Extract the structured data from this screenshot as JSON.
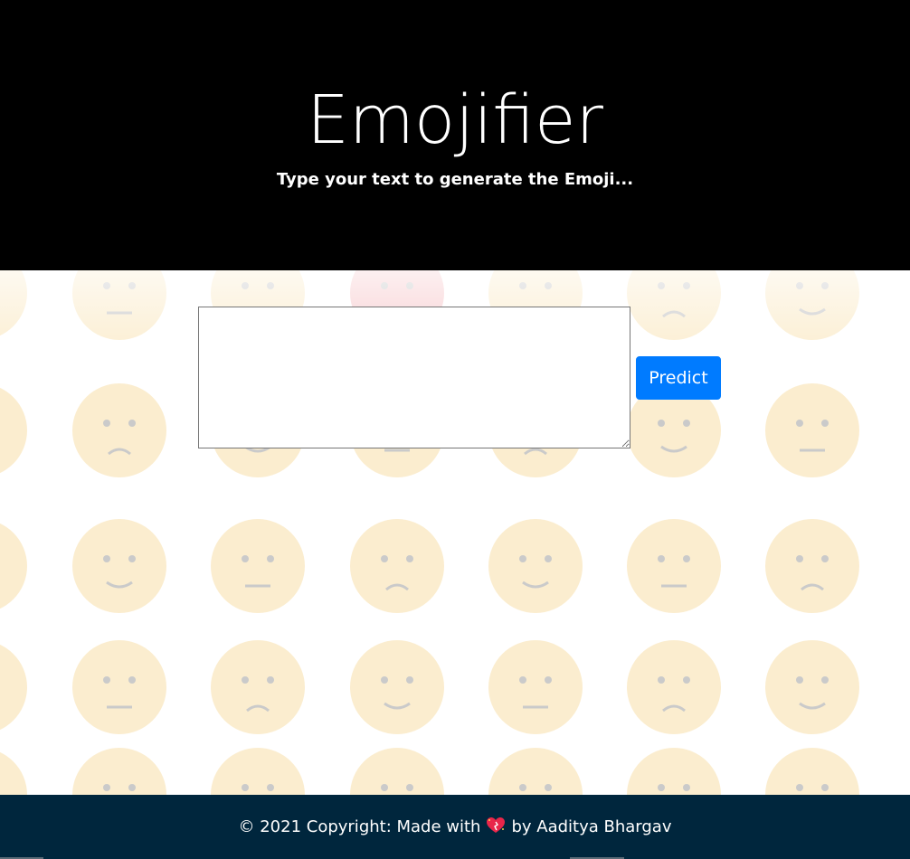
{
  "header": {
    "title": "Emojifier",
    "subtitle": "Type your text to generate the Emoji..."
  },
  "form": {
    "text_value": "",
    "predict_label": "Predict"
  },
  "footer": {
    "text_before": "© 2021 Copyright: Made with",
    "heart_icon": "sparkling-heart-icon",
    "text_after": "by Aaditya Bhargav"
  },
  "colors": {
    "header_bg": "#000000",
    "button_bg": "#007bff",
    "footer_bg": "#00263d",
    "emoji_face": "#f8dfa8",
    "emoji_feature": "#a0a0a0"
  },
  "background_icons": "faded-emoji-face-pattern"
}
